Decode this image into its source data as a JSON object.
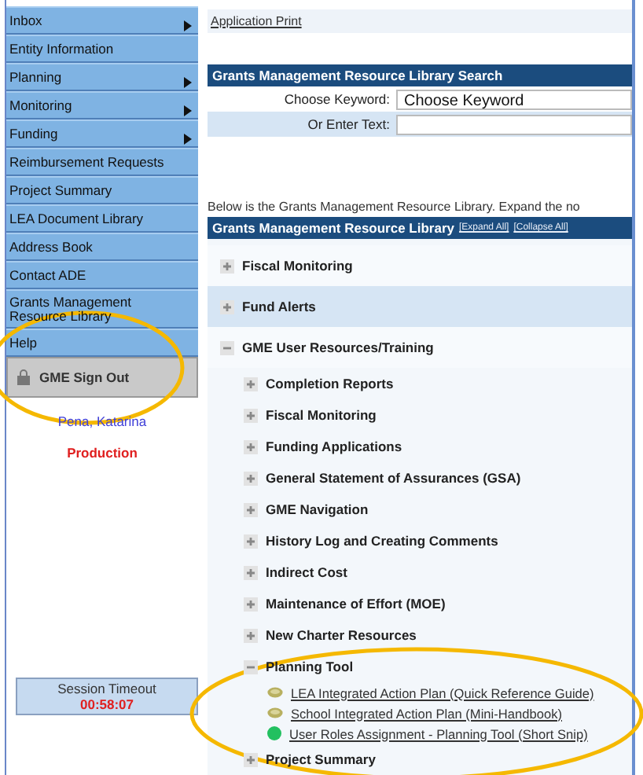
{
  "menu": {
    "items": [
      {
        "label": "Inbox",
        "submenu": true
      },
      {
        "label": "Entity Information",
        "submenu": false
      },
      {
        "label": "Planning",
        "submenu": true
      },
      {
        "label": "Monitoring",
        "submenu": true
      },
      {
        "label": "Funding",
        "submenu": true
      },
      {
        "label": "Reimbursement Requests",
        "submenu": false
      },
      {
        "label": "Project Summary",
        "submenu": false
      },
      {
        "label": "LEA Document Library",
        "submenu": false
      },
      {
        "label": "Address Book",
        "submenu": false
      },
      {
        "label": "Contact ADE",
        "submenu": false
      },
      {
        "label": "Grants Management Resource Library",
        "submenu": false
      },
      {
        "label": "Help",
        "submenu": false
      }
    ]
  },
  "sign_out": {
    "label": "GME Sign Out"
  },
  "user": {
    "name": "Pena, Katarina",
    "environment": "Production"
  },
  "session": {
    "label": "Session Timeout",
    "time": "00:58:07"
  },
  "application_print": "Application Print",
  "search": {
    "title": "Grants Management Resource Library Search",
    "fields": [
      {
        "label": "Choose Keyword:",
        "kind": "select",
        "value": "Choose Keyword"
      },
      {
        "label": "Or Enter Text:",
        "kind": "text"
      }
    ]
  },
  "intro": "Below is the Grants Management Resource Library. Expand the no",
  "library": {
    "title": "Grants Management Resource Library",
    "actions": [
      "[Expand All]",
      "[Collapse All]"
    ],
    "tree": [
      {
        "label": "Fiscal Monitoring",
        "kind": "folder",
        "expanded": false,
        "highlighted": false
      },
      {
        "label": "Fund Alerts",
        "kind": "folder",
        "expanded": false,
        "highlighted": true
      },
      {
        "label": "GME User Resources/Training",
        "kind": "folder",
        "expanded": true,
        "highlighted": false,
        "children": [
          {
            "label": "Completion Reports",
            "kind": "folder",
            "expanded": false
          },
          {
            "label": "Fiscal Monitoring",
            "kind": "folder",
            "expanded": false
          },
          {
            "label": "Funding Applications",
            "kind": "folder",
            "expanded": false
          },
          {
            "label": "General Statement of Assurances (GSA)",
            "kind": "folder",
            "expanded": false
          },
          {
            "label": "GME Navigation",
            "kind": "folder",
            "expanded": false
          },
          {
            "label": "History Log and Creating Comments",
            "kind": "folder",
            "expanded": false
          },
          {
            "label": "Indirect Cost",
            "kind": "folder",
            "expanded": false
          },
          {
            "label": "Maintenance of Effort (MOE)",
            "kind": "folder",
            "expanded": false
          },
          {
            "label": "New Charter Resources",
            "kind": "folder",
            "expanded": false
          },
          {
            "label": "Planning Tool",
            "kind": "folder",
            "expanded": true,
            "children": [
              {
                "label": "LEA Integrated Action Plan (Quick Reference Guide)",
                "kind": "document"
              },
              {
                "label": "School Integrated Action Plan (Mini-Handbook)",
                "kind": "document"
              },
              {
                "label": "User Roles Assignment - Planning Tool (Short Snip)",
                "kind": "video"
              }
            ]
          },
          {
            "label": "Project Summary",
            "kind": "folder",
            "expanded": false
          }
        ]
      }
    ]
  }
}
